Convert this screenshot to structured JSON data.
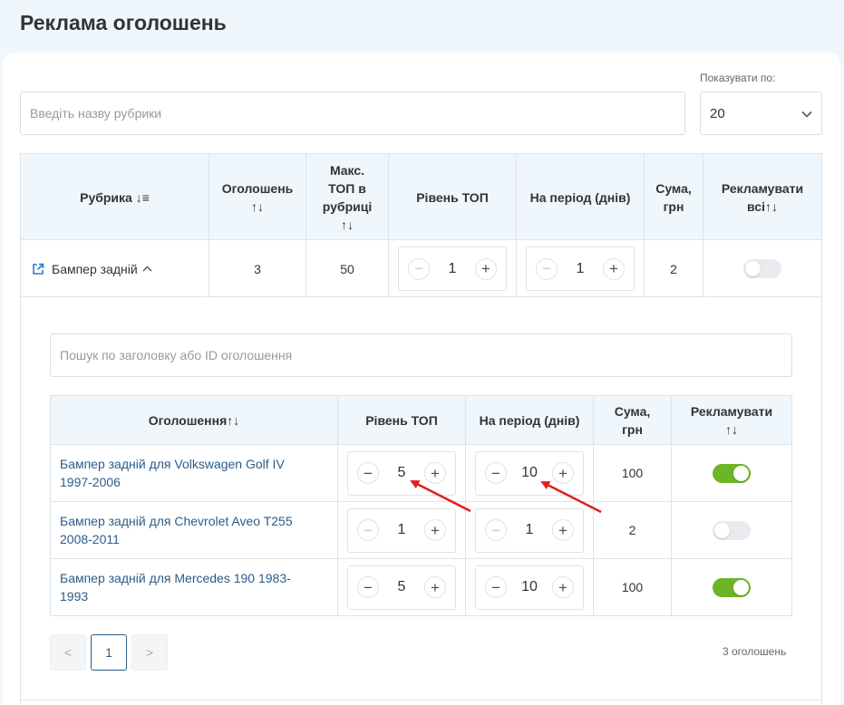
{
  "page": {
    "title": "Реклама оголошень"
  },
  "filters": {
    "search_placeholder": "Введіть назву рубрики",
    "per_page_label": "Показувати по:",
    "per_page_value": "20"
  },
  "rubrics_table": {
    "headers": {
      "rubric": "Рубрика ↓≡",
      "ads": "Оголошень",
      "ads_sort": "↑↓",
      "max_top_1": "Макс.",
      "max_top_2": "ТОП в",
      "max_top_3": "рубриці",
      "max_top_sort": "↑↓",
      "top_level": "Рівень ТОП",
      "period": "На період (днів)",
      "sum_1": "Сума,",
      "sum_2": "грн",
      "promote_all_1": "Рекламувати",
      "promote_all_2": "всі↑↓"
    },
    "row": {
      "rubric": "Бампер задній",
      "ads": "3",
      "max_top": "50",
      "top_level": "1",
      "period": "1",
      "sum": "2",
      "promote_all": false
    }
  },
  "ads_section": {
    "search_placeholder": "Пошук по заголовку або ID оголошення",
    "headers": {
      "ad": "Оголошення↑↓",
      "top_level": "Рівень ТОП",
      "period": "На період (днів)",
      "sum_1": "Сума,",
      "sum_2": "грн",
      "promote_1": "Рекламувати",
      "promote_2": "↑↓"
    },
    "rows": [
      {
        "title_1": "Бампер задній для Volkswagen Golf IV",
        "title_2": "1997-2006",
        "top_level": "5",
        "period": "10",
        "sum": "100",
        "promote": true
      },
      {
        "title_1": "Бампер задній для Chevrolet Aveo T255",
        "title_2": "2008-2011",
        "top_level": "1",
        "period": "1",
        "sum": "2",
        "promote": false
      },
      {
        "title_1": "Бампер задній для Mercedes 190 1983-",
        "title_2": "1993",
        "top_level": "5",
        "period": "10",
        "sum": "100",
        "promote": true
      }
    ],
    "pagination": {
      "prev": "<",
      "current": "1",
      "next": ">",
      "count": "3 оголошень"
    }
  },
  "colors": {
    "accent": "#2b5c8a",
    "toggle_on": "#6db526",
    "header_bg": "#f0f7fc",
    "annotation_arrow": "#e02020"
  }
}
